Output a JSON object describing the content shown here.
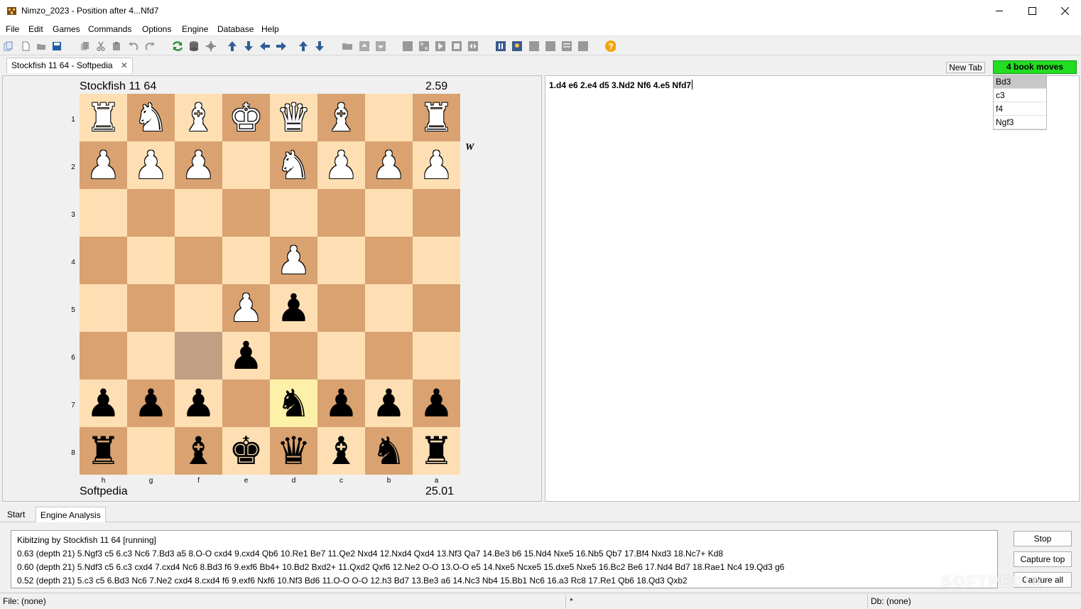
{
  "window": {
    "app_name": "Nimzo_2023",
    "separator": " - ",
    "document_title": "Position after 4...Nfd7"
  },
  "menu": [
    "File",
    "Edit",
    "Games",
    "Commands",
    "Options",
    "Engine",
    "Database",
    "Help"
  ],
  "toolbar_icons": [
    "copy-icon",
    "new-file-icon",
    "open-folder-icon",
    "save-icon",
    "copy-icon",
    "cut-icon",
    "paste-icon",
    "undo-icon",
    "redo-icon",
    "refresh-icon",
    "database-icon",
    "engine-icon",
    "arrow-up-icon",
    "arrow-down-icon",
    "arrow-left-icon",
    "arrow-right-icon",
    "arrow-up-icon",
    "arrow-down-icon",
    "folder-icon",
    "up-level-icon",
    "down-level-icon",
    "stop-icon",
    "board-icon",
    "play-icon",
    "stop-square-icon",
    "flip-icon",
    "pause-icon",
    "image-icon",
    "square-icon",
    "square-icon",
    "list-icon",
    "square-icon",
    "help-icon"
  ],
  "doc_tab": {
    "label": "Stockfish 11 64 - Softpedia",
    "close": "✕"
  },
  "new_tab_label": "New Tab",
  "book_moves_label": "4 book moves",
  "book_moves": [
    "Bd3",
    "c3",
    "f4",
    "Ngf3"
  ],
  "board": {
    "player_top": "Stockfish 11 64",
    "eval_top": "2.59",
    "player_bottom": "Softpedia",
    "eval_bottom": "25.01",
    "side_to_move": "W",
    "ranks": [
      "1",
      "2",
      "3",
      "4",
      "5",
      "6",
      "7",
      "8"
    ],
    "files": [
      "h",
      "g",
      "f",
      "e",
      "d",
      "c",
      "b",
      "a"
    ],
    "rows": [
      [
        "wR",
        "wN",
        "wB",
        "wK",
        "wQ",
        "wB",
        "",
        "wR"
      ],
      [
        "wP",
        "wP",
        "wP",
        "",
        "wN",
        "wP",
        "wP",
        "wP"
      ],
      [
        "",
        "",
        "",
        "",
        "",
        "",
        "",
        ""
      ],
      [
        "",
        "",
        "",
        "",
        "wP",
        "",
        "",
        ""
      ],
      [
        "",
        "",
        "",
        "wP",
        "bP",
        "",
        "",
        ""
      ],
      [
        "",
        "",
        "",
        "bP",
        "",
        "",
        "",
        ""
      ],
      [
        "bP",
        "bP",
        "bP",
        "",
        "bN",
        "bP",
        "bP",
        "bP"
      ],
      [
        "bR",
        "",
        "bB",
        "bK",
        "bQ",
        "bB",
        "bN",
        "bR"
      ]
    ]
  },
  "notation": "1.d4 e6 2.e4 d5 3.Nd2 Nf6 4.e5 Nfd7",
  "bottom_tabs": [
    "Start",
    "Engine Analysis"
  ],
  "analysis": {
    "header": "Kibitzing by Stockfish 11 64 [running]",
    "lines": [
      "0.63 (depth 21) 5.Ngf3 c5 6.c3 Nc6 7.Bd3 a5 8.O-O cxd4 9.cxd4 Qb6 10.Re1 Be7 11.Qe2 Nxd4 12.Nxd4 Qxd4 13.Nf3 Qa7 14.Be3 b6 15.Nd4 Nxe5 16.Nb5 Qb7 17.Bf4 Nxd3 18.Nc7+ Kd8",
      "0.60 (depth 21) 5.Ndf3 c5 6.c3 cxd4 7.cxd4 Nc6 8.Bd3 f6 9.exf6 Bb4+ 10.Bd2 Bxd2+ 11.Qxd2 Qxf6 12.Ne2 O-O 13.O-O e5 14.Nxe5 Ncxe5 15.dxe5 Nxe5 16.Bc2 Be6 17.Nd4 Bd7 18.Rae1 Nc4 19.Qd3 g6",
      "0.52 (depth 21) 5.c3 c5 6.Bd3 Nc6 7.Ne2 cxd4 8.cxd4 f6 9.exf6 Nxf6 10.Nf3 Bd6 11.O-O O-O 12.h3 Bd7 13.Be3 a6 14.Nc3 Nb4 15.Bb1 Nc6 16.a3 Rc8 17.Re1 Qb6 18.Qd3 Qxb2"
    ],
    "buttons": [
      "Stop",
      "Capture top",
      "Capture all"
    ]
  },
  "status": {
    "file": "File: (none)",
    "modified": "*",
    "db": "Db: (none)"
  },
  "watermark": "SOFTPEDIA"
}
